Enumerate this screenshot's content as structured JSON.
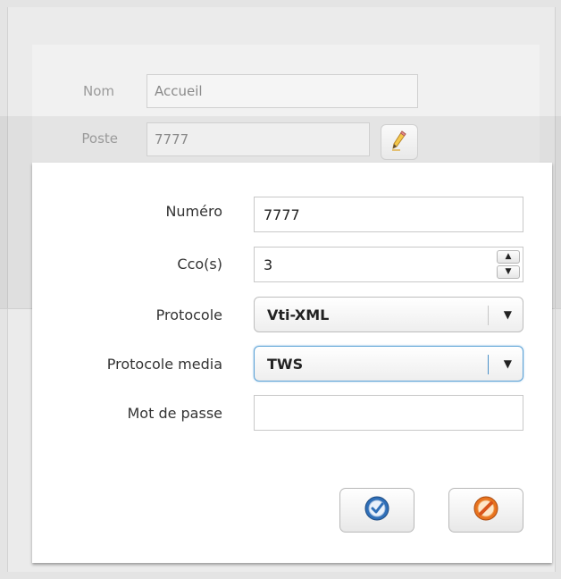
{
  "background_form": {
    "nom_label": "Nom",
    "nom_value": "Accueil",
    "poste_label": "Poste",
    "poste_value": "7777"
  },
  "dialog": {
    "numero_label": "Numéro",
    "numero_value": "7777",
    "cco_label": "Cco(s)",
    "cco_value": "3",
    "protocole_label": "Protocole",
    "protocole_value": "Vti-XML",
    "protocole_media_label": "Protocole media",
    "protocole_media_value": "TWS",
    "password_label": "Mot de passe",
    "password_value": ""
  },
  "icons": {
    "edit": "pencil-icon",
    "confirm": "confirm-check-icon",
    "cancel": "cancel-icon",
    "spin_up": "triangle-up-icon",
    "spin_down": "triangle-down-icon",
    "dropdown": "triangle-down-icon"
  },
  "colors": {
    "focus_border": "#5aa1d6",
    "confirm_blue": "#2f6fb8",
    "cancel_orange": "#e8731e"
  }
}
